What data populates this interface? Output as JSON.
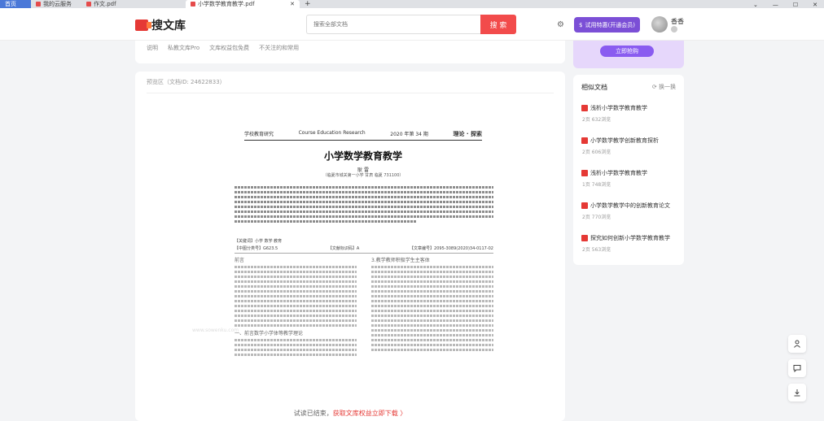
{
  "tabs": [
    {
      "label": "首页"
    },
    {
      "label": "我的云服务"
    },
    {
      "label": "作文.pdf"
    },
    {
      "label": "小学数学教育教学.pdf"
    }
  ],
  "header": {
    "logo_text": "搜文库",
    "search_placeholder": "搜索全部文档",
    "search_button": "搜 索",
    "vip_button": "试用特惠(开通会员)",
    "username": "香香"
  },
  "strip_links": [
    "说明",
    "私教文库Pro",
    "文库权益包免费",
    "不关注的和常用"
  ],
  "promo": {
    "button": "立即抢购"
  },
  "doc": {
    "preview_label": "预览区（文档ID: 24622833）",
    "journal_name": "学校教育研究",
    "journal_en": "Course Education Research",
    "issue": "2020 年第 34 期",
    "section": "理论 · 探索",
    "title": "小学数学教育教学",
    "author": "耿 雷",
    "affiliation": "（临夏市城关第一小学 甘肃 临夏 731100）",
    "keywords": "【关键词】小学 数学 教育",
    "class_no": "【中图分类号】G623.5",
    "doc_code": "【文献标识码】A",
    "article_no": "【文章编号】2095-3089(2020)34-0117-02",
    "left_head": "前言",
    "left_sub": "一、前言数学小学体等教学理论",
    "right_head": "3.教学教师积极学生主客体",
    "watermark": "www.sowenku.com",
    "trial_text": "试读已结束，",
    "trial_link": "获取文库权益立即下载 〉"
  },
  "sidebar": {
    "title": "相似文档",
    "refresh": "换一换",
    "items": [
      {
        "title": "浅析小学数学教育教学",
        "pages": "2页",
        "views": "632浏览"
      },
      {
        "title": "小学数学教学创新教育探析",
        "pages": "2页",
        "views": "606浏览"
      },
      {
        "title": "浅析小学数学教育教学",
        "pages": "1页",
        "views": "748浏览"
      },
      {
        "title": "小学数学教学中的创新教育论文",
        "pages": "2页",
        "views": "770浏览"
      },
      {
        "title": "探究如何创新小学数学教育教学",
        "pages": "2页",
        "views": "563浏览"
      }
    ]
  },
  "icons": {
    "user": "user-icon",
    "comment": "comment-icon",
    "download": "download-icon",
    "settings": "gear-icon"
  }
}
